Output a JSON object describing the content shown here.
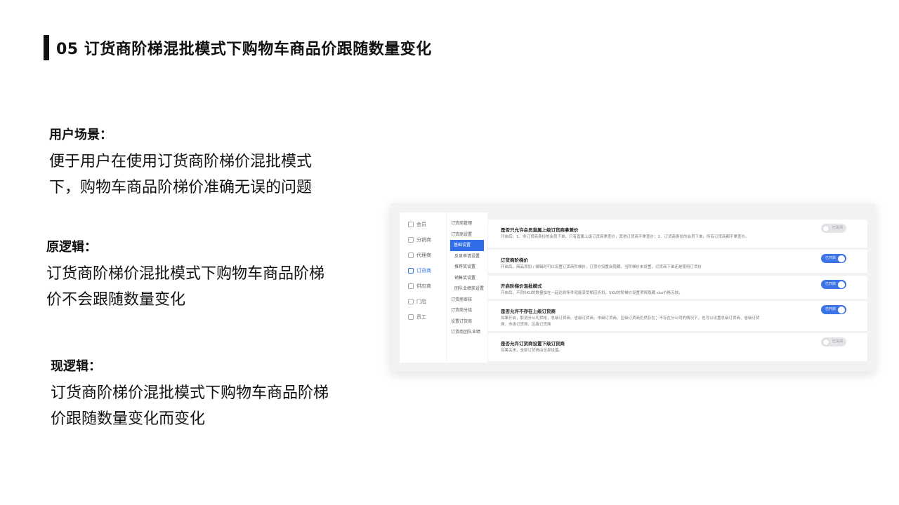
{
  "slide": {
    "title": "05 订货商阶梯混批模式下购物车商品价跟随数量变化"
  },
  "scenario": {
    "heading": "用户场景：",
    "lines": [
      "便于用户在使用订货商阶梯价混批模式",
      "下，购物车商品阶梯价准确无误的问题"
    ]
  },
  "old_logic": {
    "heading": "原逻辑：",
    "lines": [
      "订货商阶梯价混批模式下购物车商品阶梯",
      "价不会跟随数量变化"
    ]
  },
  "new_logic": {
    "heading": "现逻辑：",
    "lines": [
      "订货商阶梯价混批模式下购物车商品阶梯",
      "价跟随数量变化而变化"
    ]
  },
  "screenshot": {
    "nav_primary": [
      {
        "label": "会员",
        "icon": "member-icon",
        "active": false
      },
      {
        "label": "分销商",
        "icon": "distributor-icon",
        "active": false
      },
      {
        "label": "代理商",
        "icon": "agent-icon",
        "active": false
      },
      {
        "label": "订货商",
        "icon": "orderer-icon",
        "active": true
      },
      {
        "label": "供应商",
        "icon": "supplier-icon",
        "active": false
      },
      {
        "label": "门店",
        "icon": "store-icon",
        "active": false
      },
      {
        "label": "员工",
        "icon": "staff-icon",
        "active": false
      }
    ],
    "nav_secondary": [
      {
        "label": "订货商管理",
        "sub": false,
        "selected": false
      },
      {
        "label": "订货商设置",
        "sub": false,
        "selected": false
      },
      {
        "label": "基础设置",
        "sub": true,
        "selected": true
      },
      {
        "label": "反显申请设置",
        "sub": true,
        "selected": false
      },
      {
        "label": "推荐奖设置",
        "sub": true,
        "selected": false
      },
      {
        "label": "销售奖设置",
        "sub": true,
        "selected": false
      },
      {
        "label": "团队业绩奖设置",
        "sub": true,
        "selected": false
      },
      {
        "label": "订货商审核",
        "sub": false,
        "selected": false
      },
      {
        "label": "订货商分组",
        "sub": false,
        "selected": false
      },
      {
        "label": "设置订货商",
        "sub": false,
        "selected": false
      },
      {
        "label": "订货商团队业绩",
        "sub": false,
        "selected": false
      }
    ],
    "settings": [
      {
        "title": "是否只允许会员直属上级订货商拿差价",
        "desc": "开启后，1、非订货商身份的会员下单，只有直属上级订货商拿差价，其他订货商不拿差价；2、订货商身份的会员下单，所有订货商都不拿差价。",
        "state": "已关闭",
        "on": false
      },
      {
        "title": "订货商阶梯价",
        "desc": "开启后，商品添加 / 编辑时可以设置订货商阶梯价，订货价设置会隐藏，当阶梯价未设置，订货商下单还是使用订货价",
        "state": "已开启",
        "on": true
      },
      {
        "title": "开启阶梯价混批模式",
        "desc": "开启后，不同SKU的数量加在一起达到条件就能享受相应折扣，SKU的阶梯价设置项将隐藏,sku价格无效。",
        "state": "已开启",
        "on": true
      },
      {
        "title": "是否允许不存在上级订货商",
        "desc": "如果开启，取消分公司货帐，总级订货商、省级订货商、市级订货商、区级订货商仍然存在；不存在分公司的情况下，也可以设置总级订货商、省级订货商、市级订货商、区级订货商",
        "state": "已开启",
        "on": true
      },
      {
        "title": "是否允许订货商设置下级订货商",
        "desc": "如果关闭，全部订货商由总部设置。",
        "state": "已关闭",
        "on": false
      }
    ]
  }
}
